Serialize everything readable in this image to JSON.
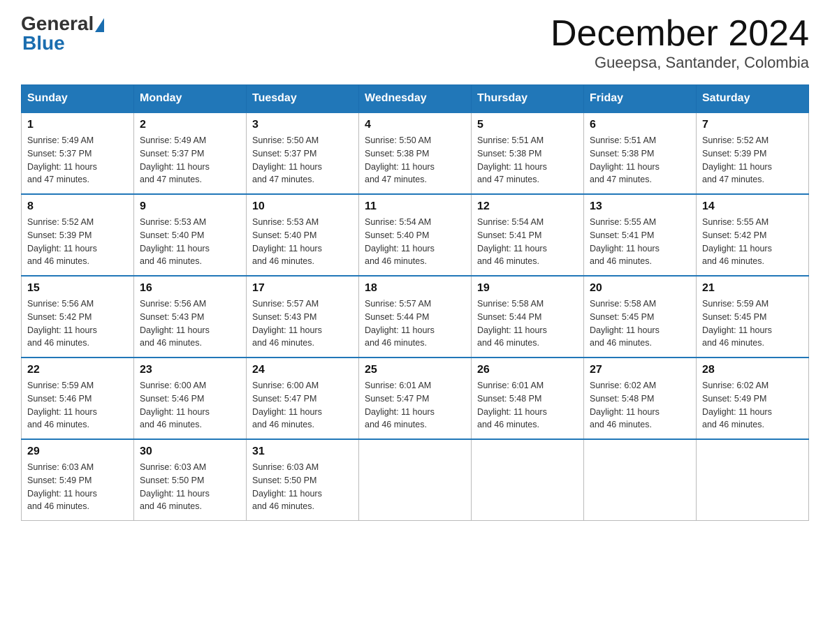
{
  "header": {
    "logo_general": "General",
    "logo_blue": "Blue",
    "title": "December 2024",
    "location": "Gueepsa, Santander, Colombia"
  },
  "calendar": {
    "days_of_week": [
      "Sunday",
      "Monday",
      "Tuesday",
      "Wednesday",
      "Thursday",
      "Friday",
      "Saturday"
    ],
    "weeks": [
      [
        {
          "day": "1",
          "sunrise": "5:49 AM",
          "sunset": "5:37 PM",
          "daylight": "11 hours and 47 minutes."
        },
        {
          "day": "2",
          "sunrise": "5:49 AM",
          "sunset": "5:37 PM",
          "daylight": "11 hours and 47 minutes."
        },
        {
          "day": "3",
          "sunrise": "5:50 AM",
          "sunset": "5:37 PM",
          "daylight": "11 hours and 47 minutes."
        },
        {
          "day": "4",
          "sunrise": "5:50 AM",
          "sunset": "5:38 PM",
          "daylight": "11 hours and 47 minutes."
        },
        {
          "day": "5",
          "sunrise": "5:51 AM",
          "sunset": "5:38 PM",
          "daylight": "11 hours and 47 minutes."
        },
        {
          "day": "6",
          "sunrise": "5:51 AM",
          "sunset": "5:38 PM",
          "daylight": "11 hours and 47 minutes."
        },
        {
          "day": "7",
          "sunrise": "5:52 AM",
          "sunset": "5:39 PM",
          "daylight": "11 hours and 47 minutes."
        }
      ],
      [
        {
          "day": "8",
          "sunrise": "5:52 AM",
          "sunset": "5:39 PM",
          "daylight": "11 hours and 46 minutes."
        },
        {
          "day": "9",
          "sunrise": "5:53 AM",
          "sunset": "5:40 PM",
          "daylight": "11 hours and 46 minutes."
        },
        {
          "day": "10",
          "sunrise": "5:53 AM",
          "sunset": "5:40 PM",
          "daylight": "11 hours and 46 minutes."
        },
        {
          "day": "11",
          "sunrise": "5:54 AM",
          "sunset": "5:40 PM",
          "daylight": "11 hours and 46 minutes."
        },
        {
          "day": "12",
          "sunrise": "5:54 AM",
          "sunset": "5:41 PM",
          "daylight": "11 hours and 46 minutes."
        },
        {
          "day": "13",
          "sunrise": "5:55 AM",
          "sunset": "5:41 PM",
          "daylight": "11 hours and 46 minutes."
        },
        {
          "day": "14",
          "sunrise": "5:55 AM",
          "sunset": "5:42 PM",
          "daylight": "11 hours and 46 minutes."
        }
      ],
      [
        {
          "day": "15",
          "sunrise": "5:56 AM",
          "sunset": "5:42 PM",
          "daylight": "11 hours and 46 minutes."
        },
        {
          "day": "16",
          "sunrise": "5:56 AM",
          "sunset": "5:43 PM",
          "daylight": "11 hours and 46 minutes."
        },
        {
          "day": "17",
          "sunrise": "5:57 AM",
          "sunset": "5:43 PM",
          "daylight": "11 hours and 46 minutes."
        },
        {
          "day": "18",
          "sunrise": "5:57 AM",
          "sunset": "5:44 PM",
          "daylight": "11 hours and 46 minutes."
        },
        {
          "day": "19",
          "sunrise": "5:58 AM",
          "sunset": "5:44 PM",
          "daylight": "11 hours and 46 minutes."
        },
        {
          "day": "20",
          "sunrise": "5:58 AM",
          "sunset": "5:45 PM",
          "daylight": "11 hours and 46 minutes."
        },
        {
          "day": "21",
          "sunrise": "5:59 AM",
          "sunset": "5:45 PM",
          "daylight": "11 hours and 46 minutes."
        }
      ],
      [
        {
          "day": "22",
          "sunrise": "5:59 AM",
          "sunset": "5:46 PM",
          "daylight": "11 hours and 46 minutes."
        },
        {
          "day": "23",
          "sunrise": "6:00 AM",
          "sunset": "5:46 PM",
          "daylight": "11 hours and 46 minutes."
        },
        {
          "day": "24",
          "sunrise": "6:00 AM",
          "sunset": "5:47 PM",
          "daylight": "11 hours and 46 minutes."
        },
        {
          "day": "25",
          "sunrise": "6:01 AM",
          "sunset": "5:47 PM",
          "daylight": "11 hours and 46 minutes."
        },
        {
          "day": "26",
          "sunrise": "6:01 AM",
          "sunset": "5:48 PM",
          "daylight": "11 hours and 46 minutes."
        },
        {
          "day": "27",
          "sunrise": "6:02 AM",
          "sunset": "5:48 PM",
          "daylight": "11 hours and 46 minutes."
        },
        {
          "day": "28",
          "sunrise": "6:02 AM",
          "sunset": "5:49 PM",
          "daylight": "11 hours and 46 minutes."
        }
      ],
      [
        {
          "day": "29",
          "sunrise": "6:03 AM",
          "sunset": "5:49 PM",
          "daylight": "11 hours and 46 minutes."
        },
        {
          "day": "30",
          "sunrise": "6:03 AM",
          "sunset": "5:50 PM",
          "daylight": "11 hours and 46 minutes."
        },
        {
          "day": "31",
          "sunrise": "6:03 AM",
          "sunset": "5:50 PM",
          "daylight": "11 hours and 46 minutes."
        },
        null,
        null,
        null,
        null
      ]
    ]
  }
}
